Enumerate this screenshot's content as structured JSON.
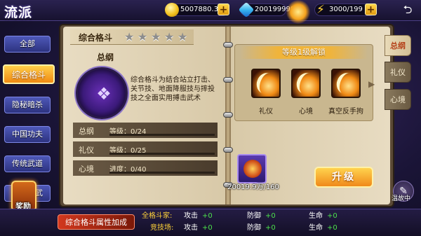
{
  "header": {
    "title": "流派",
    "gold": "5007880.3万",
    "diamonds": "200199999",
    "energy": "3000/199"
  },
  "sidebar": {
    "items": [
      {
        "label": "全部"
      },
      {
        "label": "综合格斗"
      },
      {
        "label": "隐秘暗杀"
      },
      {
        "label": "中国功夫"
      },
      {
        "label": "传统武道"
      },
      {
        "label": "秘传古武"
      }
    ],
    "reward_label": "奖励"
  },
  "book": {
    "header": "综合格斗",
    "stars_total": 5,
    "stars_filled": 0,
    "section_title": "总纲",
    "description": "综合格斗为结合站立打击、关节技、地面降服技与摔投技之全面实用搏击武术",
    "stats": [
      {
        "label": "总纲",
        "key": "等级",
        "value": "0/24",
        "progress": 0
      },
      {
        "label": "礼仪",
        "key": "等级",
        "value": "0/25",
        "progress": 0
      },
      {
        "label": "心境",
        "key": "进度",
        "value": "0/40",
        "progress": 0
      }
    ],
    "unlock_title": "等级1级解锁",
    "unlock_skills": [
      {
        "label": "礼仪",
        "icon": "flame-slash-icon"
      },
      {
        "label": "心境",
        "icon": "flame-slash-icon"
      },
      {
        "label": "真空反手拘",
        "icon": "flame-slash-icon"
      }
    ],
    "tabs": [
      "总纲",
      "礼仪",
      "心境"
    ],
    "item_count": "20019.9万/160",
    "upgrade_label": "升级",
    "tray_label": "温故中"
  },
  "bottom": {
    "attr_button": "综合格斗属性加成",
    "rows": [
      {
        "label": "全格斗家:",
        "attack": "攻击",
        "attack_val": "+0",
        "defense": "防御",
        "defense_val": "+0",
        "life": "生命",
        "life_val": "+0"
      },
      {
        "label": "竞技场:",
        "attack": "攻击",
        "attack_val": "+0",
        "defense": "防御",
        "defense_val": "+0",
        "life": "生命",
        "life_val": "+0"
      }
    ]
  },
  "colors": {
    "accent": "#f0a020",
    "page": "#e3d6b8",
    "positive": "#4ce04c"
  }
}
